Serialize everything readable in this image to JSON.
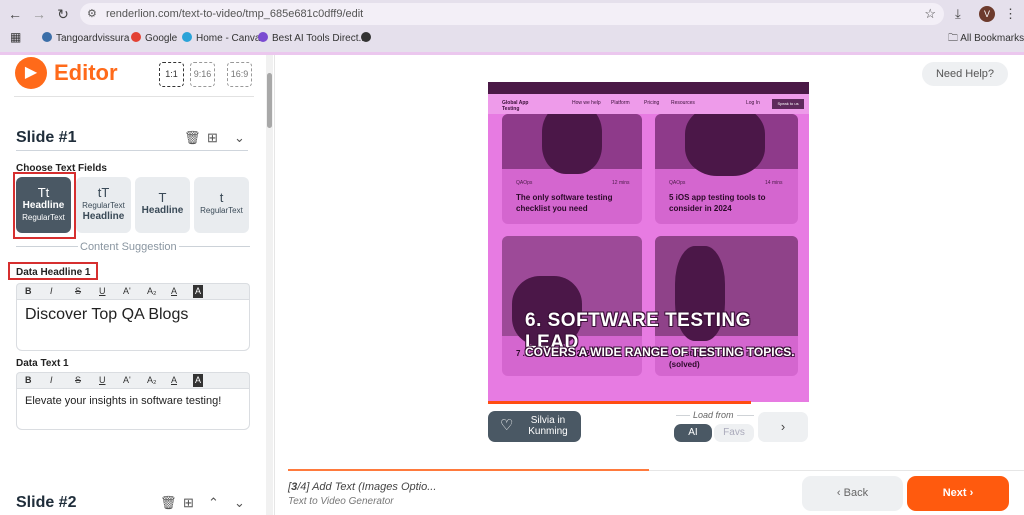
{
  "browser": {
    "url": "renderlion.com/text-to-video/tmp_685e681c0dff9/edit",
    "avatar_letter": "V",
    "bookmarks": [
      "Tangoardvissura -",
      "Google",
      "Home - Canva",
      "Best AI Tools Direct..."
    ],
    "all_bookmarks": "All Bookmarks"
  },
  "editor": {
    "logo": "Editor",
    "ratios": [
      "1:1",
      "9:16",
      "16:9"
    ],
    "slide1_title": "Slide #1",
    "choose_text_fields": "Choose Text Fields",
    "tiles": [
      {
        "a": "Tt",
        "b": "Headline",
        "c": "RegularText"
      },
      {
        "a": "tT",
        "c": "RegularText",
        "b": "Headline"
      },
      {
        "a": "T",
        "b": "Headline"
      },
      {
        "a": "t",
        "c": "RegularText"
      }
    ],
    "content_suggestion": "Content Suggestion",
    "data_headline_label": "Data Headline 1",
    "headline_value": "Discover Top QA Blogs",
    "data_text_label": "Data Text 1",
    "text_value": "Elevate your insights in software testing!",
    "format_tools": [
      "B",
      "I",
      "S",
      "U",
      "A'",
      "A₂",
      "A",
      "A"
    ],
    "slide2_title": "Slide #2"
  },
  "preview": {
    "need_help": "Need Help?",
    "site_brand": "Global App Testing",
    "site_nav": [
      "How we help",
      "Platform",
      "Pricing",
      "Resources",
      "Log In",
      "Speak to us"
    ],
    "cards": [
      {
        "meta": "QAOps",
        "mins": "12 mins",
        "title": "The only software testing checklist you need"
      },
      {
        "meta": "QAOps",
        "mins": "14 mins",
        "title": "5 iOS app testing tools to consider in 2024"
      },
      {
        "meta": "",
        "mins": "",
        "title": "7 ... consider in 2024"
      },
      {
        "meta": "",
        "mins": "",
        "title": "... testing to have in mind (solved)"
      }
    ],
    "caption_big": "6. SOFTWARE TESTING LEAD",
    "caption_small": "COVERS A WIDE RANGE OF TESTING TOPICS.",
    "voice_name": "Silvia in Kunming",
    "load_from": "Load from",
    "ai": "AI",
    "favs": "Favs",
    "video_progress": 0.82
  },
  "footer": {
    "step_current": "3",
    "step_total": "/4]",
    "step_label": "Add Text (Images Optio...",
    "step_sub": "Text to Video Generator",
    "progress": 0.49,
    "back": "Back",
    "next": "Next"
  }
}
